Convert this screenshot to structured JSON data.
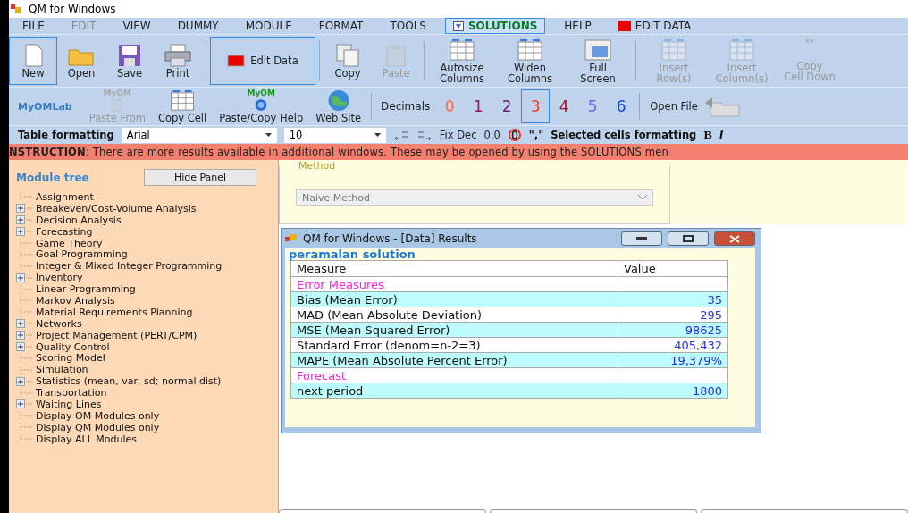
{
  "window": {
    "title": "QM for Windows"
  },
  "menu": [
    {
      "label": "FILE",
      "disabled": false,
      "selected": false,
      "kind": "text"
    },
    {
      "label": "EDIT",
      "disabled": true,
      "selected": false,
      "kind": "text"
    },
    {
      "label": "VIEW",
      "disabled": false,
      "selected": false,
      "kind": "text"
    },
    {
      "label": "DUMMY",
      "disabled": false,
      "selected": false,
      "kind": "text"
    },
    {
      "label": "MODULE",
      "disabled": false,
      "selected": false,
      "kind": "text"
    },
    {
      "label": "FORMAT",
      "disabled": false,
      "selected": false,
      "kind": "text"
    },
    {
      "label": "TOOLS",
      "disabled": false,
      "selected": false,
      "kind": "text"
    },
    {
      "label": "SOLUTIONS",
      "disabled": false,
      "selected": true,
      "kind": "solutions"
    },
    {
      "label": "HELP",
      "disabled": false,
      "selected": false,
      "kind": "text"
    },
    {
      "label": "EDIT DATA",
      "disabled": false,
      "selected": false,
      "kind": "editdata"
    }
  ],
  "toolbar": [
    {
      "label": "New",
      "kind": "page",
      "disabled": false,
      "selected": true
    },
    {
      "label": "Open",
      "kind": "folder",
      "disabled": false,
      "selected": false
    },
    {
      "label": "Save",
      "kind": "disk",
      "disabled": false,
      "selected": false
    },
    {
      "label": "Print",
      "kind": "printer",
      "disabled": false,
      "selected": false
    },
    {
      "label": "Edit Data",
      "kind": "editdata",
      "disabled": false,
      "selected": true
    },
    {
      "label": "Copy",
      "kind": "copy",
      "disabled": false,
      "selected": false
    },
    {
      "label": "Paste",
      "kind": "clipboard",
      "disabled": true,
      "selected": false
    },
    {
      "label": "Autosize Columns",
      "kind": "grid",
      "disabled": false,
      "selected": false
    },
    {
      "label": "Widen Columns",
      "kind": "grid",
      "disabled": false,
      "selected": false
    },
    {
      "label": "Full Screen",
      "kind": "screen",
      "disabled": false,
      "selected": false
    },
    {
      "label": "Insert Row(s)",
      "kind": "grid",
      "disabled": true,
      "selected": false
    },
    {
      "label": "Insert Column(s)",
      "kind": "grid",
      "disabled": true,
      "selected": false
    },
    {
      "label": "Copy Cell Down",
      "kind": "quote",
      "disabled": true,
      "selected": false
    }
  ],
  "toolbar2": {
    "lab": "MyOMLab",
    "items": [
      {
        "label": "Paste From",
        "badge": "MyOM",
        "kind": "clipboard",
        "disabled": true
      },
      {
        "label": "Copy Cell",
        "kind": "grid",
        "disabled": false
      },
      {
        "label": "Paste/Copy Help",
        "badge": "MyOM",
        "kind": "help",
        "disabled": false
      },
      {
        "label": "Web Site",
        "kind": "globe",
        "disabled": false
      }
    ],
    "decimals_label": "Decimals",
    "decimals": [
      {
        "label": "0",
        "color": "#ff6a3d",
        "selected": false
      },
      {
        "label": "1",
        "color": "#a0105a",
        "selected": false
      },
      {
        "label": "2",
        "color": "#6a1a6a",
        "selected": false
      },
      {
        "label": "3",
        "color": "#ff3a1a",
        "selected": true
      },
      {
        "label": "4",
        "color": "#a0102a",
        "selected": false
      },
      {
        "label": "5",
        "color": "#6a6ae0",
        "selected": false
      },
      {
        "label": "6",
        "color": "#1040e0",
        "selected": false
      }
    ],
    "open_file": "Open File"
  },
  "format_bar": {
    "label": "Table formatting",
    "font": "Arial",
    "size": "10",
    "fix_dec": "Fix Dec",
    "fix_value": "0.0",
    "comma": "\",\"",
    "selected_label": "Selected cells formatting",
    "bold": "B",
    "italic": "I"
  },
  "instruction": "**NSTRUCTION**:  There are more results available in additional windows. These may be opened by using the SOLUTIONS men",
  "module_tree": {
    "title": "Module tree",
    "hide_button": "Hide Panel",
    "items": [
      {
        "label": "Assignment",
        "expandable": false
      },
      {
        "label": "Breakeven/Cost-Volume Analysis",
        "expandable": true
      },
      {
        "label": "Decision Analysis",
        "expandable": true
      },
      {
        "label": "Forecasting",
        "expandable": true
      },
      {
        "label": "Game Theory",
        "expandable": false
      },
      {
        "label": "Goal Programming",
        "expandable": false
      },
      {
        "label": "Integer & Mixed Integer Programming",
        "expandable": false
      },
      {
        "label": "Inventory",
        "expandable": true
      },
      {
        "label": "Linear Programming",
        "expandable": false
      },
      {
        "label": "Markov Analysis",
        "expandable": false
      },
      {
        "label": "Material Requirements Planning",
        "expandable": false
      },
      {
        "label": "Networks",
        "expandable": true
      },
      {
        "label": "Project Management (PERT/CPM)",
        "expandable": true
      },
      {
        "label": "Quality Control",
        "expandable": true
      },
      {
        "label": "Scoring Model",
        "expandable": false
      },
      {
        "label": "Simulation",
        "expandable": false
      },
      {
        "label": "Statistics (mean, var, sd; normal dist)",
        "expandable": true
      },
      {
        "label": "Transportation",
        "expandable": false
      },
      {
        "label": "Waiting Lines",
        "expandable": true
      },
      {
        "label": "Display OM Modules only",
        "expandable": false
      },
      {
        "label": "Display QM Modules only",
        "expandable": false
      },
      {
        "label": "Display ALL Modules",
        "expandable": false
      }
    ]
  },
  "method": {
    "legend": "Method",
    "value": "Naive Method",
    "disabled": true
  },
  "results": {
    "title": "QM for Windows - [Data] Results",
    "heading": "peramalan solution",
    "columns": [
      "Measure",
      "Value"
    ],
    "rows": [
      {
        "kind": "section",
        "measure": "Error Measures",
        "value": "",
        "shaded": false
      },
      {
        "kind": "row",
        "measure": "Bias (Mean Error)",
        "value": "35",
        "shaded": true
      },
      {
        "kind": "row",
        "measure": "MAD (Mean Absolute Deviation)",
        "value": "295",
        "shaded": false
      },
      {
        "kind": "row",
        "measure": "MSE (Mean Squared Error)",
        "value": "98625",
        "shaded": true
      },
      {
        "kind": "row",
        "measure": "Standard Error (denom=n-2=3)",
        "value": "405,432",
        "shaded": false
      },
      {
        "kind": "row",
        "measure": "MAPE (Mean Absolute Percent Error)",
        "value": "19,379%",
        "shaded": true
      },
      {
        "kind": "section",
        "measure": "Forecast",
        "value": "",
        "shaded": false
      },
      {
        "kind": "row",
        "measure": "next period",
        "value": "1800",
        "shaded": true
      }
    ]
  }
}
